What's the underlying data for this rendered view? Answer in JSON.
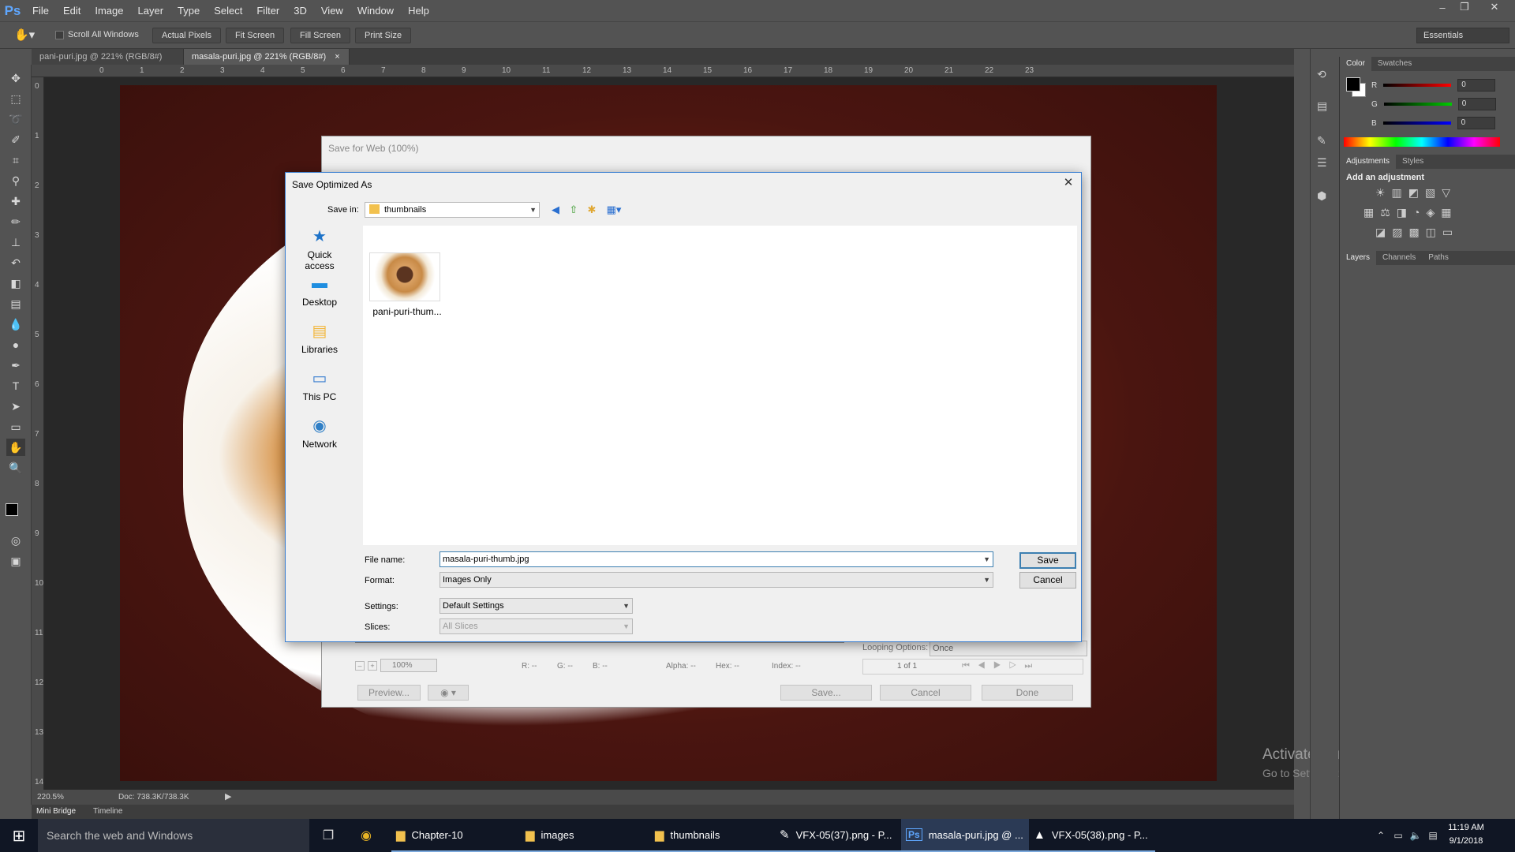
{
  "app": {
    "logo": "Ps"
  },
  "menu": [
    "File",
    "Edit",
    "Image",
    "Layer",
    "Type",
    "Select",
    "Filter",
    "3D",
    "View",
    "Window",
    "Help"
  ],
  "window_controls": {
    "minimize": "–",
    "restore": "❐",
    "close": "✕"
  },
  "options_bar": {
    "scroll_all_windows": "Scroll All Windows",
    "actual_pixels": "Actual Pixels",
    "fit_screen": "Fit Screen",
    "fill_screen": "Fill Screen",
    "print_size": "Print Size",
    "workspace": "Essentials"
  },
  "doc_tabs": [
    {
      "label": "pani-puri.jpg @ 221% (RGB/8#)",
      "close": "×"
    },
    {
      "label": "masala-puri.jpg @ 221% (RGB/8#)",
      "close": "×"
    }
  ],
  "ruler_top": [
    "0",
    "1",
    "2",
    "3",
    "4",
    "5",
    "6",
    "7",
    "8",
    "9",
    "10",
    "11",
    "12",
    "13",
    "14",
    "15",
    "16",
    "17",
    "18",
    "19",
    "20",
    "21",
    "22",
    "23"
  ],
  "ruler_left": [
    "0",
    "1",
    "2",
    "3",
    "4",
    "5",
    "6",
    "7",
    "8",
    "9",
    "10",
    "11",
    "12",
    "13",
    "14"
  ],
  "status": {
    "zoom": "220.5%",
    "doc": "Doc: 738.3K/738.3K"
  },
  "bottom_tabs": {
    "mini_bridge": "Mini Bridge",
    "timeline": "Timeline"
  },
  "watermark": {
    "line1": "Activate Windows",
    "line2": "Go to Settings to activate Windows."
  },
  "panels": {
    "color_tabs": [
      "Color",
      "Swatches"
    ],
    "rgb": [
      {
        "label": "R",
        "value": "0"
      },
      {
        "label": "G",
        "value": "0"
      },
      {
        "label": "B",
        "value": "0"
      }
    ],
    "adjust_tabs": [
      "Adjustments",
      "Styles"
    ],
    "add_adjustment": "Add an adjustment",
    "layer_tabs": [
      "Layers",
      "Channels",
      "Paths"
    ]
  },
  "save_for_web": {
    "title": "Save for Web (100%)",
    "zoom": "100%",
    "readout": {
      "r": "R: --",
      "g": "G: --",
      "b": "B: --",
      "alpha": "Alpha: --",
      "hex": "Hex: --",
      "index": "Index: --"
    },
    "looping_label": "Looping Options:",
    "looping_value": "Once",
    "frame": "1 of 1",
    "preview": "Preview...",
    "save": "Save...",
    "cancel": "Cancel",
    "done": "Done"
  },
  "dialog": {
    "title": "Save Optimized As",
    "close": "✕",
    "save_in_label": "Save in:",
    "save_in_value": "thumbnails",
    "places": [
      {
        "label": "Quick access",
        "icon": "star-icon",
        "glyph": "★",
        "color": "#1e73c8"
      },
      {
        "label": "Desktop",
        "icon": "desktop-icon",
        "glyph": "▬",
        "color": "#1f8ee0"
      },
      {
        "label": "Libraries",
        "icon": "libraries-icon",
        "glyph": "▤",
        "color": "#f2b63a"
      },
      {
        "label": "This PC",
        "icon": "computer-icon",
        "glyph": "▭",
        "color": "#3b7fd0"
      },
      {
        "label": "Network",
        "icon": "network-icon",
        "glyph": "◉",
        "color": "#2f7fc6"
      }
    ],
    "files": [
      {
        "name": "pani-puri-thum..."
      }
    ],
    "file_name_label": "File name:",
    "file_name_value": "masala-puri-thumb.jpg",
    "format_label": "Format:",
    "format_value": "Images Only",
    "settings_label": "Settings:",
    "settings_value": "Default Settings",
    "slices_label": "Slices:",
    "slices_value": "All Slices",
    "save_button": "Save",
    "cancel_button": "Cancel"
  },
  "taskbar": {
    "search": "Search the web and Windows",
    "items": [
      {
        "label": "Chapter-10",
        "icon": "folder-icon",
        "glyph": "▆",
        "color": "#f2c14e"
      },
      {
        "label": "images",
        "icon": "folder-icon",
        "glyph": "▆",
        "color": "#f2c14e"
      },
      {
        "label": "thumbnails",
        "icon": "folder-icon",
        "glyph": "▆",
        "color": "#f2c14e"
      },
      {
        "label": "VFX-05(37).png - P...",
        "icon": "paint-icon",
        "glyph": "✎",
        "color": "#ffffff"
      },
      {
        "label": "masala-puri.jpg @ ...",
        "icon": "photoshop-icon",
        "glyph": "Ps",
        "color": "#5fa7ff"
      },
      {
        "label": "VFX-05(38).png - P...",
        "icon": "photos-icon",
        "glyph": "▲",
        "color": "#ffffff"
      }
    ],
    "time": "11:19 AM",
    "date": "9/1/2018"
  }
}
